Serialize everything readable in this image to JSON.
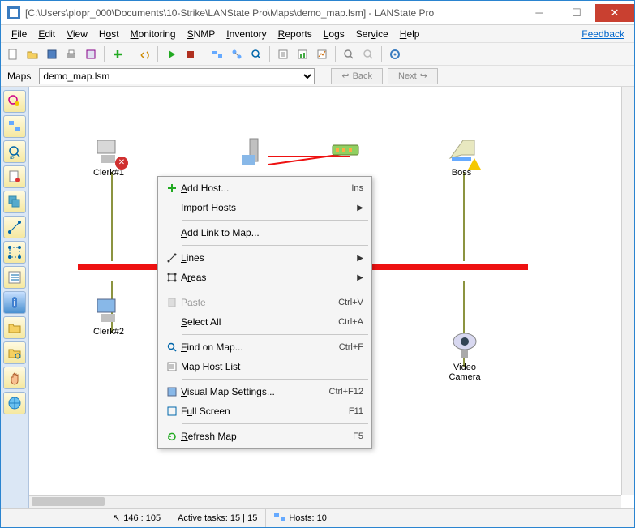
{
  "window": {
    "title": "[C:\\Users\\plopr_000\\Documents\\10-Strike\\LANState Pro\\Maps\\demo_map.lsm] - LANState Pro"
  },
  "menubar": {
    "items": [
      "File",
      "Edit",
      "View",
      "Host",
      "Monitoring",
      "SNMP",
      "Inventory",
      "Reports",
      "Logs",
      "Service",
      "Help"
    ],
    "feedback": "Feedback"
  },
  "mapsrow": {
    "label": "Maps",
    "selected": "demo_map.lsm",
    "back": "Back",
    "next": "Next"
  },
  "nodes": {
    "clerk1": "Clerk#1",
    "clerk2": "Clerk#2",
    "boss": "Boss",
    "camera": "Video Camera"
  },
  "ctx": {
    "add_host": "Add Host...",
    "add_host_sc": "Ins",
    "import_hosts": "Import Hosts",
    "add_link": "Add Link to Map...",
    "lines": "Lines",
    "areas": "Areas",
    "paste": "Paste",
    "paste_sc": "Ctrl+V",
    "select_all": "Select All",
    "select_all_sc": "Ctrl+A",
    "find": "Find on Map...",
    "find_sc": "Ctrl+F",
    "hostlist": "Map Host List",
    "visual": "Visual Map Settings...",
    "visual_sc": "Ctrl+F12",
    "fullscreen": "Full Screen",
    "fullscreen_sc": "F11",
    "refresh": "Refresh Map",
    "refresh_sc": "F5"
  },
  "status": {
    "cursor": "146 : 105",
    "tasks": "Active tasks: 15 | 15",
    "hosts": "Hosts: 10"
  }
}
